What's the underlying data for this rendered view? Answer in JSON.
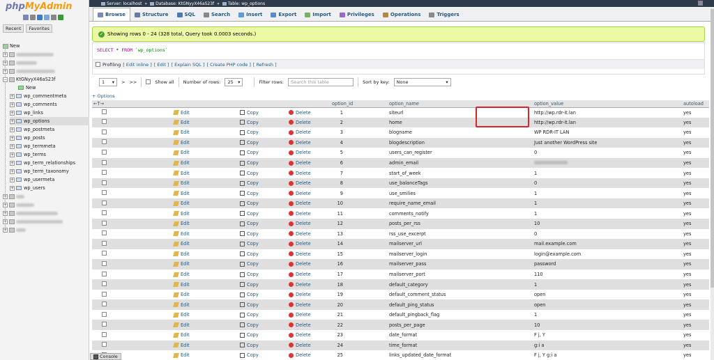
{
  "app": {
    "logo_php": "php",
    "logo_myadmin": "MyAdmin"
  },
  "sidebar": {
    "tabs": [
      "Recent",
      "Favorites"
    ],
    "new_label": "New",
    "db_name": "KtGNyyX46aS23f",
    "db_new_label": "New",
    "tables": [
      "wp_commentmeta",
      "wp_comments",
      "wp_links",
      "wp_options",
      "wp_postmeta",
      "wp_posts",
      "wp_termmeta",
      "wp_terms",
      "wp_term_relationships",
      "wp_term_taxonomy",
      "wp_usermeta",
      "wp_users"
    ],
    "selected_table": "wp_options"
  },
  "breadcrumb": {
    "server": "Server: localhost",
    "database": "Database: KtGNyyX46aS23f",
    "table": "Table: wp_options"
  },
  "nav_tabs": [
    "Browse",
    "Structure",
    "SQL",
    "Search",
    "Insert",
    "Export",
    "Import",
    "Privileges",
    "Operations",
    "Triggers"
  ],
  "message": "Showing rows 0 - 24 (328 total, Query took 0.0003 seconds.)",
  "sql": {
    "select": "SELECT",
    "star": " * ",
    "from": "FROM",
    "table": " `wp_options`"
  },
  "sql_options": {
    "profiling": "Profiling",
    "links": [
      "[ Edit inline ]",
      "[ Edit ]",
      "[ Explain SQL ]",
      "[ Create PHP code ]",
      "[ Refresh ]"
    ]
  },
  "navigation": {
    "page": "1",
    "next": ">",
    "last": ">>",
    "show_all": "Show all",
    "number_of_rows_label": "Number of rows:",
    "rows": "25",
    "filter_label": "Filter rows:",
    "filter_placeholder": "Search this table",
    "sort_label": "Sort by key:",
    "sort_value": "None"
  },
  "options_link": "+ Options",
  "table": {
    "columns": [
      "option_id",
      "option_name",
      "option_value",
      "autoload"
    ],
    "actions": {
      "edit": "Edit",
      "copy": "Copy",
      "delete": "Delete"
    },
    "rows": [
      [
        "1",
        "siteurl",
        "http://wp.rdr-it.lan",
        "yes"
      ],
      [
        "2",
        "home",
        "http://wp.rdr-it.lan",
        "yes"
      ],
      [
        "3",
        "blogname",
        "WP RDR-IT LAN",
        "yes"
      ],
      [
        "4",
        "blogdescription",
        "Just another WordPress site",
        "yes"
      ],
      [
        "5",
        "users_can_register",
        "0",
        "yes"
      ],
      [
        "6",
        "admin_email",
        "",
        "yes"
      ],
      [
        "7",
        "start_of_week",
        "1",
        "yes"
      ],
      [
        "8",
        "use_balanceTags",
        "0",
        "yes"
      ],
      [
        "9",
        "use_smilies",
        "1",
        "yes"
      ],
      [
        "10",
        "require_name_email",
        "1",
        "yes"
      ],
      [
        "11",
        "comments_notify",
        "1",
        "yes"
      ],
      [
        "12",
        "posts_per_rss",
        "10",
        "yes"
      ],
      [
        "13",
        "rss_use_excerpt",
        "0",
        "yes"
      ],
      [
        "14",
        "mailserver_url",
        "mail.example.com",
        "yes"
      ],
      [
        "15",
        "mailserver_login",
        "login@example.com",
        "yes"
      ],
      [
        "16",
        "mailserver_pass",
        "password",
        "yes"
      ],
      [
        "17",
        "mailserver_port",
        "110",
        "yes"
      ],
      [
        "18",
        "default_category",
        "1",
        "yes"
      ],
      [
        "19",
        "default_comment_status",
        "open",
        "yes"
      ],
      [
        "20",
        "default_ping_status",
        "open",
        "yes"
      ],
      [
        "21",
        "default_pingback_flag",
        "1",
        "yes"
      ],
      [
        "22",
        "posts_per_page",
        "10",
        "yes"
      ],
      [
        "23",
        "date_format",
        "F j, Y",
        "yes"
      ],
      [
        "24",
        "time_format",
        "g:i a",
        "yes"
      ],
      [
        "25",
        "links_updated_date_format",
        "F j, Y g:i a",
        "yes"
      ]
    ]
  },
  "console_label": "Console",
  "colors": {
    "accent": "#235a81",
    "highlight": "#d9232d",
    "success_bg": "#ebf8a4"
  }
}
